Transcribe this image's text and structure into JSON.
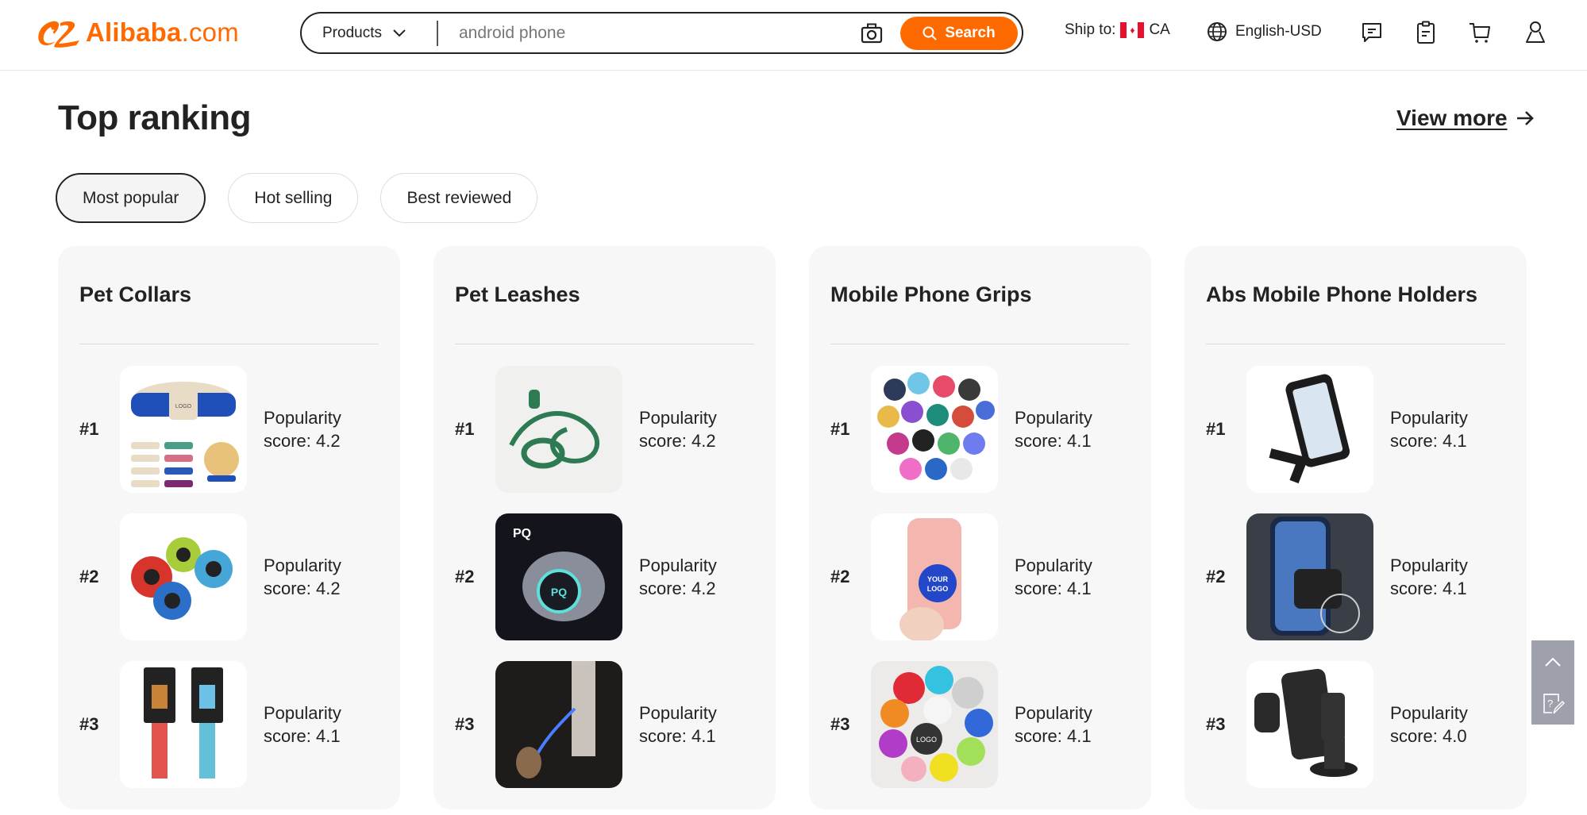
{
  "header": {
    "logo_text": "Alibaba",
    "logo_suffix": ".com",
    "search": {
      "category": "Products",
      "placeholder": "android phone",
      "value": "",
      "button_label": "Search"
    },
    "ship_to_label": "Ship to:",
    "ship_to_country": "CA",
    "language": "English-USD",
    "icons": [
      "messages-icon",
      "orders-icon",
      "cart-icon",
      "account-icon"
    ]
  },
  "section": {
    "title": "Top ranking",
    "view_more": "View more",
    "tabs": [
      {
        "label": "Most popular",
        "active": true
      },
      {
        "label": "Hot selling",
        "active": false
      },
      {
        "label": "Best reviewed",
        "active": false
      }
    ]
  },
  "categories": [
    {
      "title": "Pet Collars",
      "items": [
        {
          "rank": "#1",
          "score_label": "Popularity score: 4.2",
          "image": "blue-pet-collar-with-dog"
        },
        {
          "rank": "#2",
          "score_label": "Popularity score: 4.2",
          "image": "retractable-dog-leashes"
        },
        {
          "rank": "#3",
          "score_label": "Popularity score: 4.1",
          "image": "printed-collar-sets"
        }
      ]
    },
    {
      "title": "Pet Leashes",
      "items": [
        {
          "rank": "#1",
          "score_label": "Popularity score: 4.2",
          "image": "green-leash-harness-set"
        },
        {
          "rank": "#2",
          "score_label": "Popularity score: 4.2",
          "image": "led-retractable-leash"
        },
        {
          "rank": "#3",
          "score_label": "Popularity score: 4.1",
          "image": "glowing-leash-dog-walk"
        }
      ]
    },
    {
      "title": "Mobile Phone Grips",
      "items": [
        {
          "rank": "#1",
          "score_label": "Popularity score: 4.1",
          "image": "assorted-phone-grips"
        },
        {
          "rank": "#2",
          "score_label": "Popularity score: 4.1",
          "image": "your-logo-phone-grip"
        },
        {
          "rank": "#3",
          "score_label": "Popularity score: 4.1",
          "image": "custom-logo-grips"
        }
      ]
    },
    {
      "title": "Abs Mobile Phone Holders",
      "items": [
        {
          "rank": "#1",
          "score_label": "Popularity score: 4.1",
          "image": "bike-phone-holder"
        },
        {
          "rank": "#2",
          "score_label": "Popularity score: 4.1",
          "image": "car-vent-phone-holder"
        },
        {
          "rank": "#3",
          "score_label": "Popularity score: 4.0",
          "image": "dashboard-phone-holder"
        }
      ]
    }
  ],
  "colors": {
    "brand": "#ff6a00",
    "text": "#222222",
    "card_bg": "#f7f7f7",
    "float_bar": "#9ea1ac"
  }
}
